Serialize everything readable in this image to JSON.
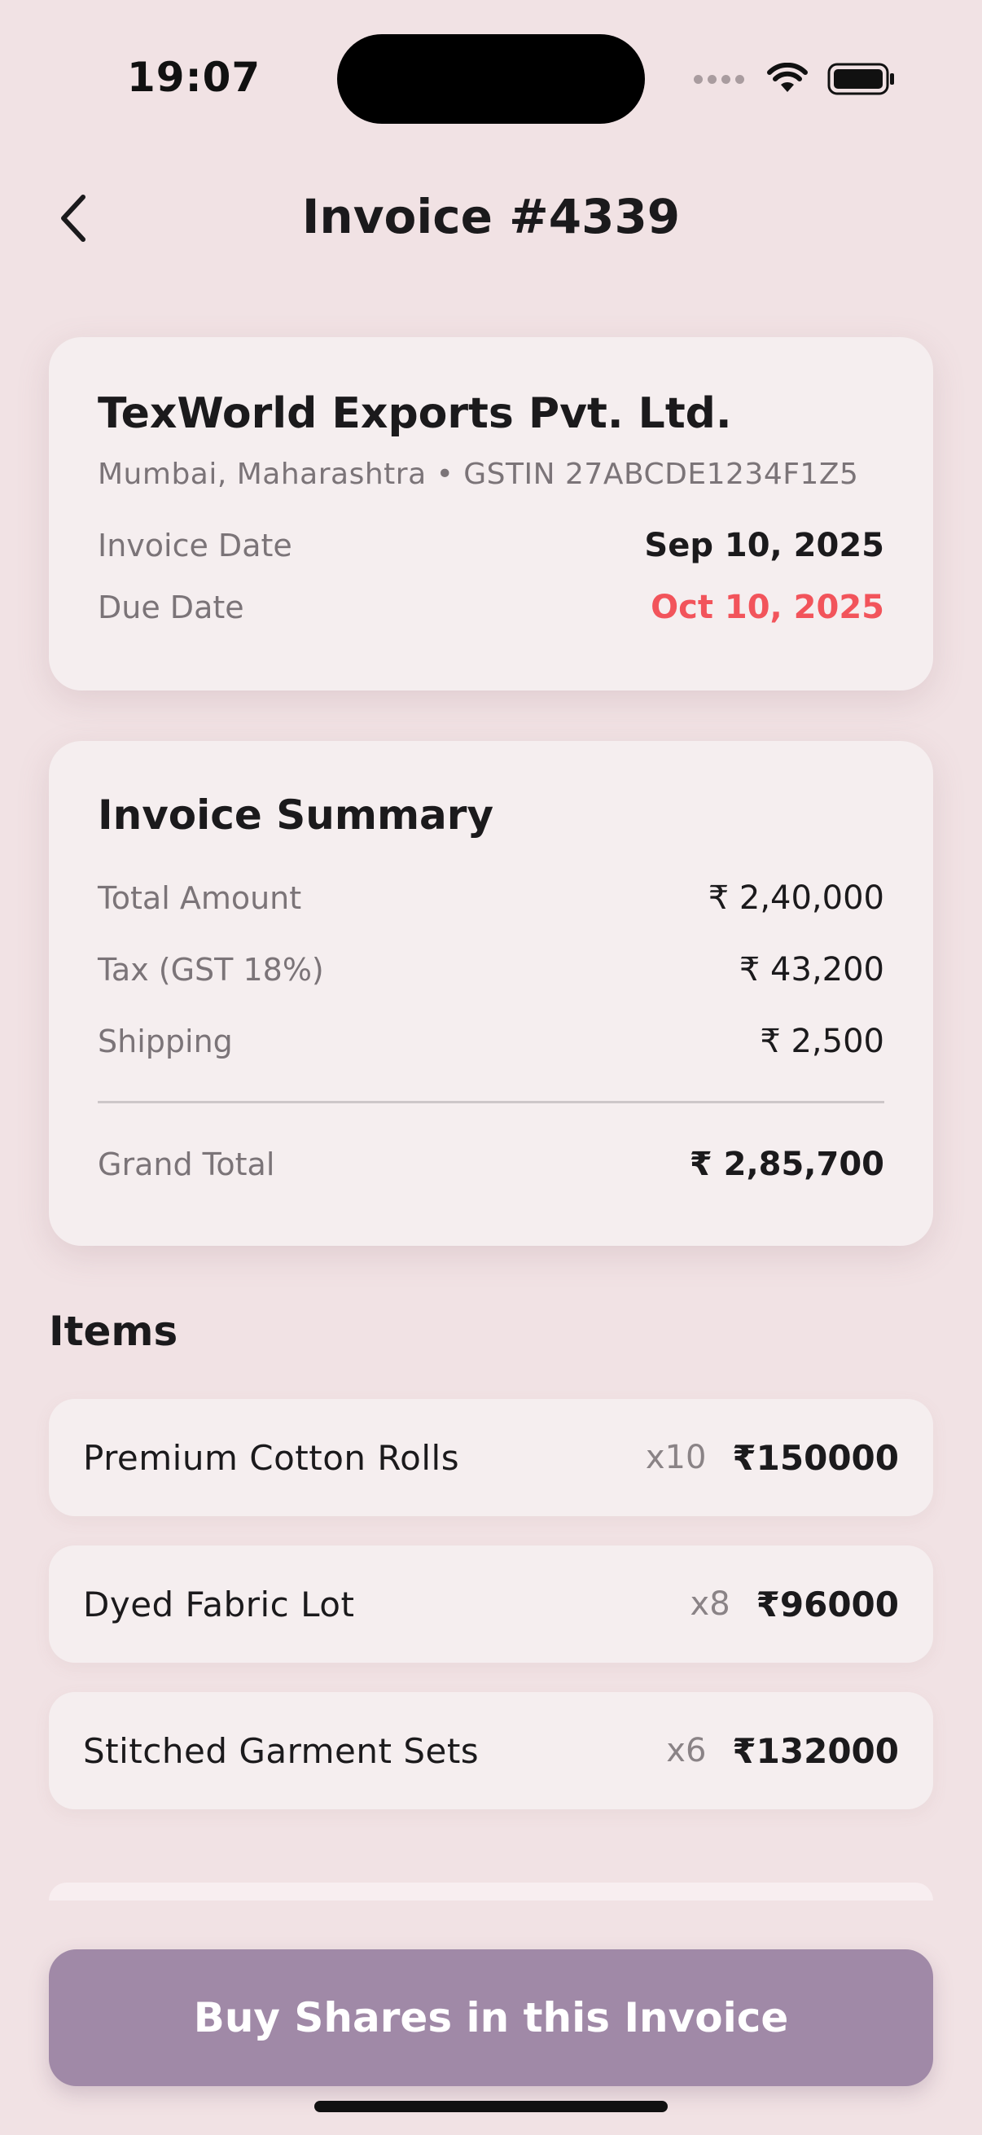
{
  "status_bar": {
    "time": "19:07"
  },
  "header": {
    "title": "Invoice #4339"
  },
  "company": {
    "name": "TexWorld Exports Pvt. Ltd.",
    "subtitle": "Mumbai, Maharashtra • GSTIN 27ABCDE1234F1Z5",
    "invoice_date_label": "Invoice Date",
    "invoice_date": "Sep 10, 2025",
    "due_date_label": "Due Date",
    "due_date": "Oct 10, 2025"
  },
  "summary": {
    "title": "Invoice Summary",
    "rows": [
      {
        "label": "Total Amount",
        "value": "₹ 2,40,000"
      },
      {
        "label": "Tax (GST 18%)",
        "value": "₹ 43,200"
      },
      {
        "label": "Shipping",
        "value": "₹ 2,500"
      }
    ],
    "grand_total_label": "Grand Total",
    "grand_total": "₹ 2,85,700"
  },
  "items": {
    "title": "Items",
    "list": [
      {
        "name": "Premium Cotton Rolls",
        "qty": "x10",
        "price": "₹150000"
      },
      {
        "name": "Dyed Fabric Lot",
        "qty": "x8",
        "price": "₹96000"
      },
      {
        "name": "Stitched Garment Sets",
        "qty": "x6",
        "price": "₹132000"
      }
    ]
  },
  "cta": {
    "label": "Buy Shares in this Invoice"
  },
  "colors": {
    "background": "#F1E2E4",
    "card": "#F5EEEF",
    "due_date": "#F2545B",
    "cta": "#A089A7"
  }
}
